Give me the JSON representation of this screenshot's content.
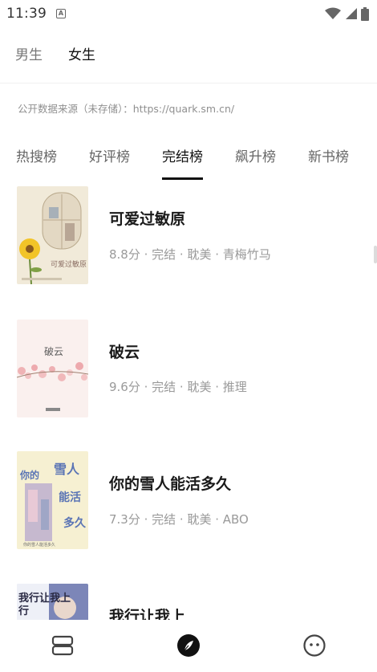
{
  "status_bar": {
    "time": "11:39",
    "notification_icon": "A"
  },
  "gender_tabs": [
    {
      "label": "男生",
      "active": false
    },
    {
      "label": "女生",
      "active": true
    }
  ],
  "source_note": "公开数据来源（未存储）：https://quark.sm.cn/",
  "rank_tabs": [
    {
      "label": "热搜榜",
      "active": false
    },
    {
      "label": "好评榜",
      "active": false
    },
    {
      "label": "完结榜",
      "active": true
    },
    {
      "label": "飙升榜",
      "active": false
    },
    {
      "label": "新书榜",
      "active": false
    }
  ],
  "books": [
    {
      "title": "可爱过敏原",
      "meta": "8.8分 · 完结 · 耽美 · 青梅竹马",
      "cover_text": "可爱过敏原"
    },
    {
      "title": "破云",
      "meta": "9.6分 · 完结 · 耽美 · 推理",
      "cover_text": "破云"
    },
    {
      "title": "你的雪人能活多久",
      "meta": "7.3分 · 完结 · 耽美 · ABO",
      "cover_text": "你的雪人能活多久"
    },
    {
      "title": "我行让我上",
      "meta": "",
      "cover_text": "我行让我上"
    }
  ],
  "bottom_nav": [
    {
      "icon": "bookshelf-icon",
      "active": false
    },
    {
      "icon": "compass-icon",
      "active": true
    },
    {
      "icon": "smiley-icon",
      "active": false
    }
  ]
}
